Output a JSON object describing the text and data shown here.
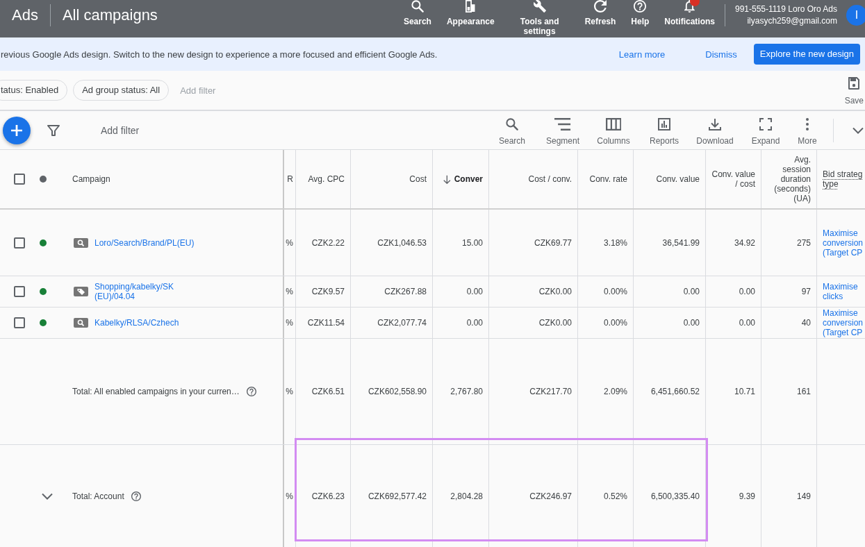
{
  "header": {
    "product": "Ads",
    "title": "All campaigns",
    "nav": [
      {
        "kind": "search",
        "label": "Search",
        "badge": false
      },
      {
        "kind": "appearance",
        "label": "Appearance",
        "badge": false
      },
      {
        "kind": "tools",
        "label": "Tools and settings",
        "badge": false
      },
      {
        "kind": "refresh",
        "label": "Refresh",
        "badge": false
      },
      {
        "kind": "help",
        "label": "Help",
        "badge": false
      },
      {
        "kind": "notifications",
        "label": "Notifications",
        "badge": true
      }
    ],
    "account": {
      "name": "991-555-1119 Loro Oro Ads",
      "email": "ilyasych259@gmail.com",
      "avatar": "I"
    }
  },
  "banner": {
    "message": "revious Google Ads design. Switch to the new design to experience a more focused and efficient Google Ads.",
    "links": [
      "Learn more",
      "Dismiss"
    ],
    "button": "Explore the new design"
  },
  "filter_bar": {
    "chips": [
      "tatus: Enabled",
      "Ad group status: All"
    ],
    "add_filter": "Add filter",
    "save": "Save"
  },
  "toolbar": {
    "add_filter": "Add filter",
    "actions": [
      {
        "kind": "search",
        "label": "Search"
      },
      {
        "kind": "segment",
        "label": "Segment"
      },
      {
        "kind": "columns",
        "label": "Columns"
      },
      {
        "kind": "reports",
        "label": "Reports"
      },
      {
        "kind": "download",
        "label": "Download"
      },
      {
        "kind": "expand",
        "label": "Expand"
      },
      {
        "kind": "more",
        "label": "More"
      }
    ]
  },
  "table": {
    "select_all_checked": false,
    "campaign_column": "Campaign",
    "columns": [
      {
        "label": "R",
        "kind": "metric",
        "sorted": false
      },
      {
        "label": "Avg. CPC",
        "kind": "metric",
        "sorted": false
      },
      {
        "label": "Cost",
        "kind": "metric",
        "sorted": false
      },
      {
        "label": "Conver",
        "kind": "metric",
        "sorted": true
      },
      {
        "label": "Cost / conv.",
        "kind": "metric",
        "sorted": false
      },
      {
        "label": "Conv. rate",
        "kind": "metric",
        "sorted": false
      },
      {
        "label": "Conv. value",
        "kind": "metric",
        "sorted": false
      },
      {
        "label": "Conv. value / cost",
        "kind": "metric",
        "sorted": false
      },
      {
        "label": "Avg. session duration (seconds) (UA)",
        "kind": "metric",
        "sorted": false
      },
      {
        "label": "Bid strateg type",
        "kind": "text",
        "sorted": false
      }
    ],
    "rows": [
      {
        "checked": false,
        "color": "#188038",
        "kind": "search",
        "name": "Loro/Search/Brand/PL(EU)",
        "cells": [
          "%",
          "CZK2.22",
          "CZK1,046.53",
          "15.00",
          "CZK69.77",
          "3.18%",
          "36,541.99",
          "34.92",
          "275",
          "Maximise conversion (Target CP"
        ]
      },
      {
        "checked": false,
        "color": "#188038",
        "kind": "shopping",
        "name": "Shopping/kabelky/SK (EU)/04.04",
        "cells": [
          "%",
          "CZK9.57",
          "CZK267.88",
          "0.00",
          "CZK0.00",
          "0.00%",
          "0.00",
          "0.00",
          "97",
          "Maximise clicks"
        ]
      },
      {
        "checked": false,
        "color": "#188038",
        "kind": "search",
        "name": "Kabelky/RLSA/Czhech",
        "cells": [
          "%",
          "CZK11.54",
          "CZK2,077.74",
          "0.00",
          "CZK0.00",
          "0.00%",
          "0.00",
          "0.00",
          "40",
          "Maximise conversion (Target CP"
        ]
      }
    ],
    "totals": [
      {
        "label": "Total: All enabled campaigns in your curren…",
        "expander": false,
        "cells": [
          {
            "text": "%",
            "highlighted": false
          },
          {
            "text": "CZK6.51",
            "highlighted": false
          },
          {
            "text": "CZK602,558.90",
            "highlighted": false
          },
          {
            "text": "2,767.80",
            "highlighted": false
          },
          {
            "text": "CZK217.70",
            "highlighted": false
          },
          {
            "text": "2.09%",
            "highlighted": false
          },
          {
            "text": "6,451,660.52",
            "highlighted": false
          },
          {
            "text": "10.71",
            "highlighted": false
          },
          {
            "text": "161",
            "highlighted": false
          }
        ]
      },
      {
        "label": "Total: Account",
        "expander": true,
        "cells": [
          {
            "text": "%",
            "highlighted": false
          },
          {
            "text": "CZK6.23",
            "highlighted": true
          },
          {
            "text": "CZK692,577.42",
            "highlighted": true
          },
          {
            "text": "2,804.28",
            "highlighted": true
          },
          {
            "text": "CZK246.97",
            "highlighted": true
          },
          {
            "text": "0.52%",
            "highlighted": true
          },
          {
            "text": "6,500,335.40",
            "highlighted": true
          },
          {
            "text": "9.39",
            "highlighted": false
          },
          {
            "text": "149",
            "highlighted": false
          }
        ]
      }
    ]
  }
}
